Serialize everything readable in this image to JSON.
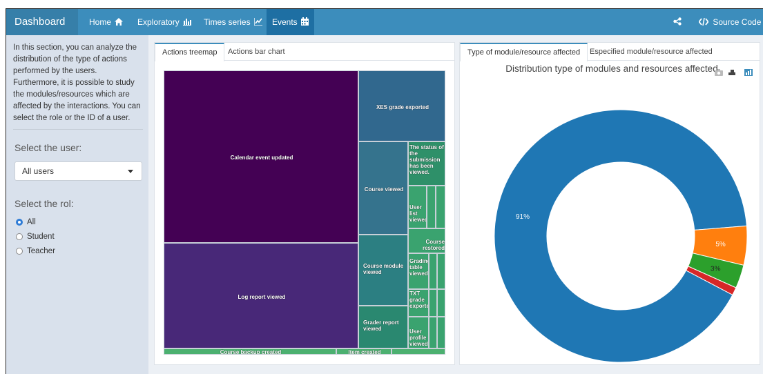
{
  "app": {
    "title": "Dashboard"
  },
  "nav": {
    "items": [
      {
        "label": "Home",
        "icon": "home-icon"
      },
      {
        "label": "Exploratory",
        "icon": "bar-chart-icon"
      },
      {
        "label": "Times series",
        "icon": "line-chart-icon"
      },
      {
        "label": "Events",
        "icon": "calendar-icon"
      }
    ],
    "active": "Events",
    "share_icon": "share-icon",
    "source_code": "Source Code",
    "source_icon": "code-icon"
  },
  "sidebar": {
    "intro": "In this section, you can analyze the distribution of the type of actions performed by the users. Furthermore, it is possible to study the modules/resources which are affected by the interactions. You can select the role or the ID of a user.",
    "user_label": "Select the user:",
    "user_value": "All users",
    "rol_label": "Select the rol:",
    "roles": [
      "All",
      "Student",
      "Teacher"
    ],
    "role_selected": "All"
  },
  "left_panel": {
    "tabs": [
      "Actions treemap",
      "Actions bar chart"
    ],
    "active_tab": "Actions treemap"
  },
  "right_panel": {
    "tabs": [
      "Type of module/resource affected",
      "Especified module/resource affected"
    ],
    "active_tab": "Type of module/resource affected"
  },
  "treemap": {
    "type": "treemap",
    "labels": [
      "Calendar event updated",
      "Log report viewed",
      "XES grade exported",
      "Course viewed",
      "Course module viewed",
      "Grader report viewed",
      "The status of the submission has been viewed.",
      "User list viewed",
      "Course restored",
      "Grading table viewed",
      "TXT grade exported",
      "User profile viewed",
      "Course backup created",
      "Item created"
    ],
    "colors": {
      "calendar": "#440154",
      "log": "#482878",
      "xes": "#31688e",
      "course": "#35738d",
      "module": "#2c7f82",
      "grader": "#2a8870",
      "status": "#2e9069",
      "small": "#3aa36f",
      "bottom": "#4cb070"
    }
  },
  "chart_data": {
    "type": "pie",
    "title": "Distribution type of modules and resources affected",
    "donut": true,
    "slices": [
      {
        "value": 91,
        "label": "91%",
        "color": "#1f77b4"
      },
      {
        "value": 5,
        "label": "5%",
        "color": "#ff7f0e"
      },
      {
        "value": 3,
        "label": "3%",
        "color": "#2ca02c"
      },
      {
        "value": 1,
        "label": "",
        "color": "#d62728"
      }
    ],
    "toolbar_icons": [
      "camera-icon",
      "zoom-icon",
      "bar-chart-icon"
    ]
  }
}
